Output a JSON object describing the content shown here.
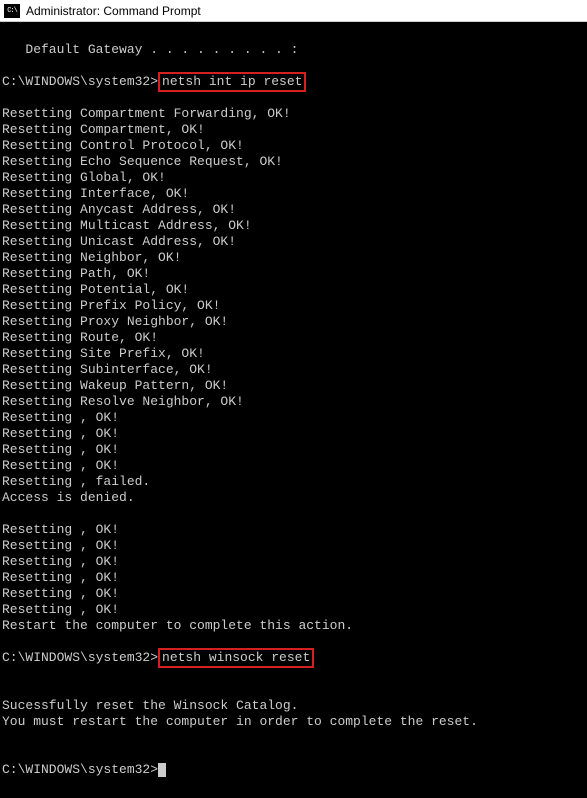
{
  "window": {
    "icon_text": "C:\\",
    "title": "Administrator: Command Prompt"
  },
  "terminal": {
    "line_gateway": "   Default Gateway . . . . . . . . . :",
    "prompt1_path": "C:\\WINDOWS\\system32>",
    "cmd1": "netsh int ip reset",
    "out1_01": "Resetting Compartment Forwarding, OK!",
    "out1_02": "Resetting Compartment, OK!",
    "out1_03": "Resetting Control Protocol, OK!",
    "out1_04": "Resetting Echo Sequence Request, OK!",
    "out1_05": "Resetting Global, OK!",
    "out1_06": "Resetting Interface, OK!",
    "out1_07": "Resetting Anycast Address, OK!",
    "out1_08": "Resetting Multicast Address, OK!",
    "out1_09": "Resetting Unicast Address, OK!",
    "out1_10": "Resetting Neighbor, OK!",
    "out1_11": "Resetting Path, OK!",
    "out1_12": "Resetting Potential, OK!",
    "out1_13": "Resetting Prefix Policy, OK!",
    "out1_14": "Resetting Proxy Neighbor, OK!",
    "out1_15": "Resetting Route, OK!",
    "out1_16": "Resetting Site Prefix, OK!",
    "out1_17": "Resetting Subinterface, OK!",
    "out1_18": "Resetting Wakeup Pattern, OK!",
    "out1_19": "Resetting Resolve Neighbor, OK!",
    "out1_20": "Resetting , OK!",
    "out1_21": "Resetting , OK!",
    "out1_22": "Resetting , OK!",
    "out1_23": "Resetting , OK!",
    "out1_24": "Resetting , failed.",
    "out1_25": "Access is denied.",
    "out1_26": "",
    "out1_27": "Resetting , OK!",
    "out1_28": "Resetting , OK!",
    "out1_29": "Resetting , OK!",
    "out1_30": "Resetting , OK!",
    "out1_31": "Resetting , OK!",
    "out1_32": "Resetting , OK!",
    "out1_33": "Restart the computer to complete this action.",
    "prompt2_path": "C:\\WINDOWS\\system32>",
    "cmd2": "netsh winsock reset",
    "out2_01": "Sucessfully reset the Winsock Catalog.",
    "out2_02": "You must restart the computer in order to complete the reset.",
    "prompt3_path": "C:\\WINDOWS\\system32>"
  }
}
